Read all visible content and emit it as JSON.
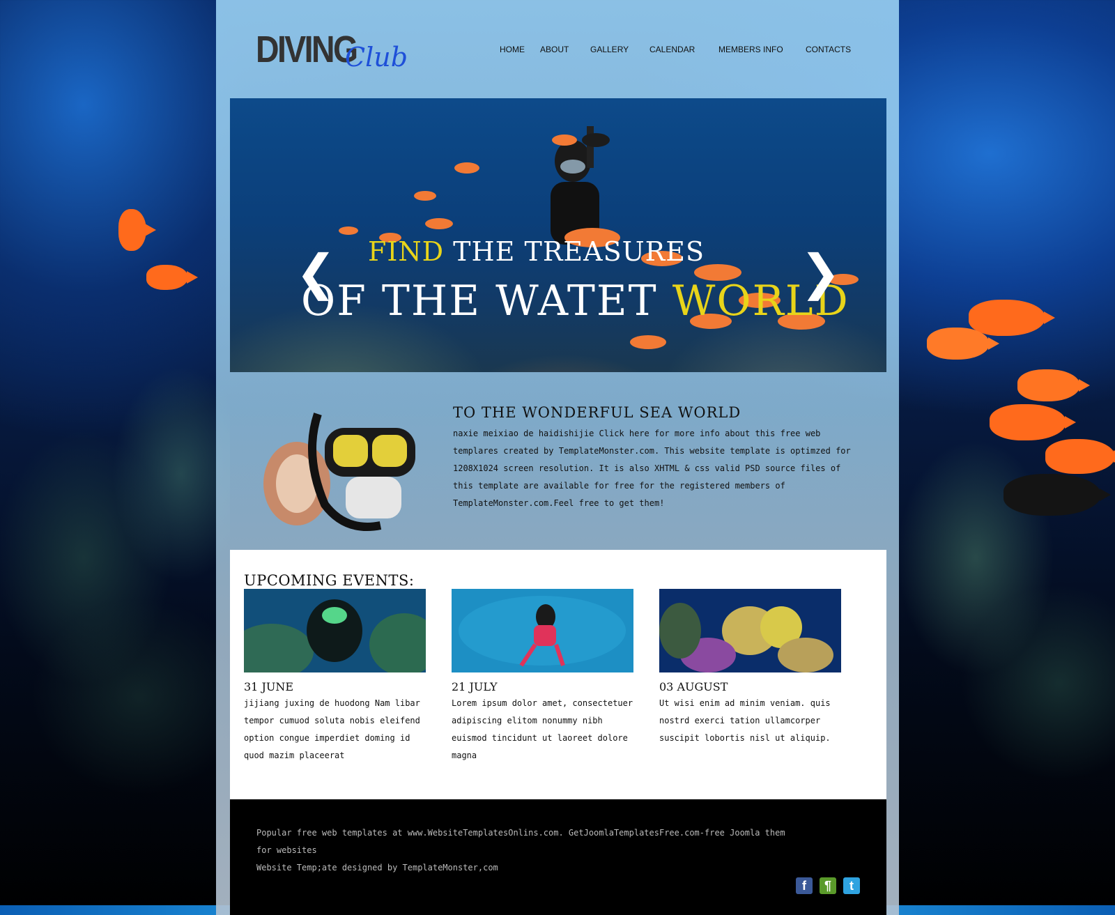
{
  "logo": {
    "main": "DIVING",
    "script": "Club"
  },
  "nav": [
    {
      "label": "HOME"
    },
    {
      "label": "ABOUT"
    },
    {
      "label": "GALLERY"
    },
    {
      "label": "CALENDAR"
    },
    {
      "label": "MEMBERS INFO"
    },
    {
      "label": "CONTACTS"
    }
  ],
  "hero": {
    "line1_highlight": "FIND",
    "line1_rest": " THE TREASURES",
    "line2_rest": "OF THE WATET ",
    "line2_highlight": "WORLD",
    "prev_arrow": "❮",
    "next_arrow": "❯"
  },
  "intro": {
    "title": "TO THE WONDERFUL SEA WORLD",
    "text": "naxie meixiao de haidishijie Click here for more info about this free web templares created by TemplateMonster.com. This website template is optimzed for 1208X1024 screen resolution. It is also XHTML & css valid PSD source files of this template are available for free for the registered members of TemplateMonster.com.Feel free to get them!"
  },
  "events": {
    "title": "UPCOMING EVENTS:",
    "items": [
      {
        "date": "31 JUNE",
        "text": "jijiang juxing de huodong Nam libar tempor cumuod soluta nobis eleifend option congue imperdiet doming id quod mazim placeerat"
      },
      {
        "date": "21 JULY",
        "text": "Lorem ipsum dolor amet, consectetuer adipiscing elitom nonummy nibh euismod tincidunt ut laoreet dolore magna"
      },
      {
        "date": "03 AUGUST",
        "text": "Ut wisi enim ad minim veniam. quis nostrd exerci tation ullamcorper suscipit lobortis nisl ut aliquip."
      }
    ]
  },
  "footer": {
    "line1": "Popular free web templates at www.WebsiteTemplatesOnlins.com. GetJoomlaTemplatesFree.com-free Joomla them for websites",
    "line2": "Website Temp;ate designed by TemplateMonster,com"
  },
  "social": [
    {
      "name": "facebook-icon",
      "glyph": "f",
      "color": "#3b5998"
    },
    {
      "name": "share-icon",
      "glyph": "¶",
      "color": "#5a9a2a"
    },
    {
      "name": "twitter-icon",
      "glyph": "t",
      "color": "#2fa3e0"
    }
  ],
  "colors": {
    "accent_yellow": "#e8d41a",
    "logo_blue": "#1e4fd8",
    "footer_bg": "#000000"
  }
}
